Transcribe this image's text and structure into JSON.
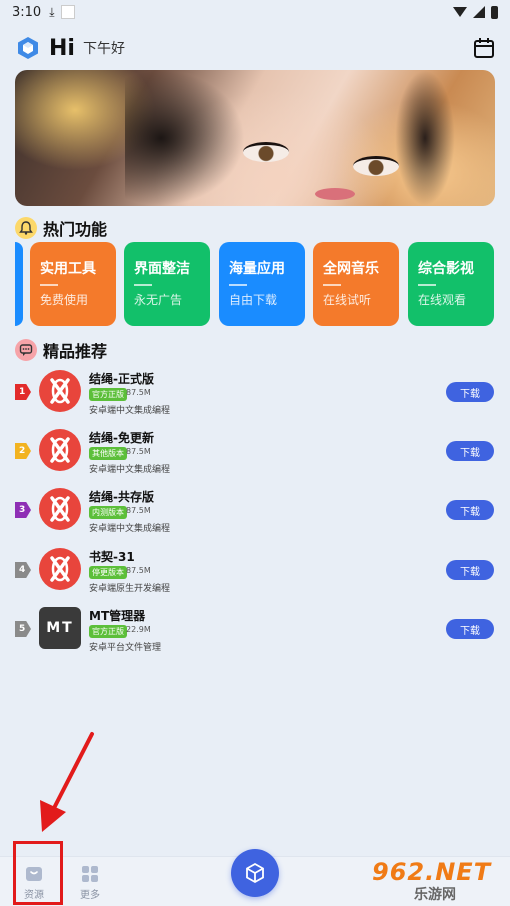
{
  "status_bar": {
    "time": "3:10"
  },
  "header": {
    "title": "Hi",
    "greeting": "下午好"
  },
  "sections": {
    "hot": "热门功能",
    "recommended": "精品推荐"
  },
  "features": [
    {
      "title": "实用工具",
      "subtitle": "免费使用",
      "color": "#f47a2b"
    },
    {
      "title": "界面整洁",
      "subtitle": "永无广告",
      "color": "#12c06a"
    },
    {
      "title": "海量应用",
      "subtitle": "自由下载",
      "color": "#1a8cff"
    },
    {
      "title": "全网音乐",
      "subtitle": "在线试听",
      "color": "#f47a2b"
    },
    {
      "title": "综合影视",
      "subtitle": "在线观看",
      "color": "#12c06a"
    }
  ],
  "apps": [
    {
      "rank": "1",
      "rank_color": "#e22b2b",
      "name": "结绳-正式版",
      "tag": "官方正版",
      "tag_color": "#5cbf3a",
      "size": "87.5M",
      "desc": "安卓端中文集成编程",
      "button": "下载",
      "icon": "jieshen-icon"
    },
    {
      "rank": "2",
      "rank_color": "#f2b321",
      "name": "结绳-免更新",
      "tag": "其他版本",
      "tag_color": "#5cbf3a",
      "size": "87.5M",
      "desc": "安卓端中文集成编程",
      "button": "下载",
      "icon": "jieshen-icon"
    },
    {
      "rank": "3",
      "rank_color": "#8e2fb5",
      "name": "结绳-共存版",
      "tag": "内测版本",
      "tag_color": "#5cbf3a",
      "size": "87.5M",
      "desc": "安卓端中文集成编程",
      "button": "下载",
      "icon": "jieshen-icon"
    },
    {
      "rank": "4",
      "rank_color": "#8a8a8a",
      "name": "书契-31",
      "tag": "停更版本",
      "tag_color": "#5cbf3a",
      "size": "87.5M",
      "desc": "安卓端原生开发编程",
      "button": "下载",
      "icon": "jieshen-icon"
    },
    {
      "rank": "5",
      "rank_color": "#8a8a8a",
      "name": "MT管理器",
      "tag": "官方正版",
      "tag_color": "#5cbf3a",
      "size": "22.9M",
      "desc": "安卓平台文件管理",
      "button": "下载",
      "icon": "mt-icon",
      "icon_text": "MT"
    }
  ],
  "nav": {
    "resources": "资源",
    "more": "更多"
  },
  "watermark": {
    "top": "962.NET",
    "bottom": "乐游网"
  },
  "colors": {
    "accent": "#3f63e0",
    "highlight": "#e21b1b"
  }
}
